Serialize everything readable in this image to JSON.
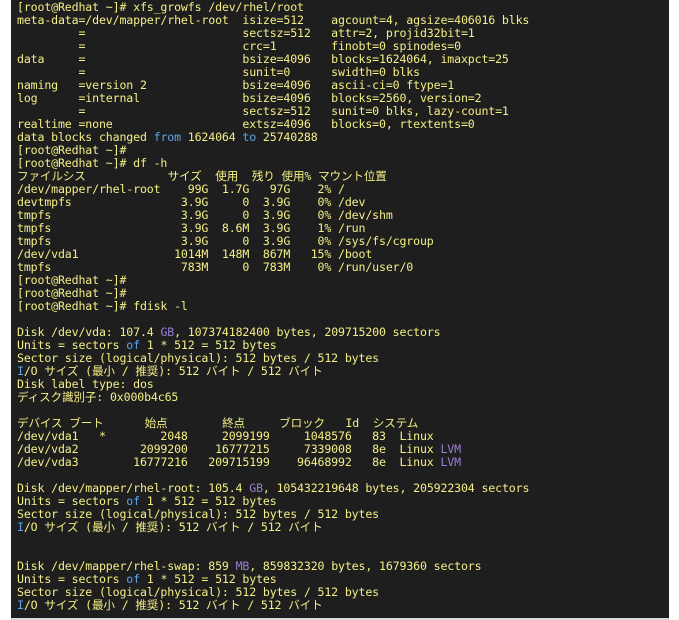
{
  "colors": {
    "background": "#1e1e1e",
    "text": "#f4ef86",
    "blue": "#5aa6e8",
    "purple": "#9a7ed6",
    "green": "#58b878"
  },
  "terminal": {
    "lines": [
      [
        {
          "t": "[root@Redhat ~]# xfs_growfs /dev/rhel/root",
          "c": "default"
        }
      ],
      [
        {
          "t": "meta-data=/dev/mapper/rhel-root  isize=512    agcount=4, agsize=406016 blks",
          "c": "default"
        }
      ],
      [
        {
          "t": "         =                       sectsz=512   attr=2, projid32bit=1",
          "c": "default"
        }
      ],
      [
        {
          "t": "         =                       crc=1        finobt=0 spinodes=0",
          "c": "default"
        }
      ],
      [
        {
          "t": "data     =                       bsize=4096   blocks=1624064, imaxpct=25",
          "c": "default"
        }
      ],
      [
        {
          "t": "         =                       sunit=0      swidth=0 blks",
          "c": "default"
        }
      ],
      [
        {
          "t": "naming   =version 2              bsize=4096   ascii-ci=0 ftype=1",
          "c": "default"
        }
      ],
      [
        {
          "t": "log      =internal               bsize=4096   blocks=2560, version=2",
          "c": "default"
        }
      ],
      [
        {
          "t": "         =                       sectsz=512   sunit=0 blks, lazy-count=1",
          "c": "default"
        }
      ],
      [
        {
          "t": "realtime =none                   extsz=4096   blocks=0, rtextents=0",
          "c": "default"
        }
      ],
      [
        {
          "t": "data blocks changed ",
          "c": "default"
        },
        {
          "t": "from",
          "c": "blue"
        },
        {
          "t": " 1624064 ",
          "c": "default"
        },
        {
          "t": "to",
          "c": "blue"
        },
        {
          "t": " 25740288",
          "c": "default"
        }
      ],
      [
        {
          "t": "[root@Redhat ~]#",
          "c": "default"
        }
      ],
      [
        {
          "t": "[root@Redhat ~]# df -h",
          "c": "default"
        }
      ],
      [
        {
          "t": "ファイルシス            サイズ  使用  残り 使用% マウント位置",
          "c": "default"
        }
      ],
      [
        {
          "t": "/dev/mapper/rhel-root    99G  1.7G   97G    2% /",
          "c": "default"
        }
      ],
      [
        {
          "t": "devtmpfs                3.9G     0  3.9G    0% /dev",
          "c": "default"
        }
      ],
      [
        {
          "t": "tmpfs                   3.9G     0  3.9G    0% /dev/shm",
          "c": "default"
        }
      ],
      [
        {
          "t": "tmpfs                   3.9G  8.6M  3.9G    1% /run",
          "c": "default"
        }
      ],
      [
        {
          "t": "tmpfs                   3.9G     0  3.9G    0% /sys/fs/cgroup",
          "c": "default"
        }
      ],
      [
        {
          "t": "/dev/vda1              1014M  148M  867M   15% /boot",
          "c": "default"
        }
      ],
      [
        {
          "t": "tmpfs                   783M     0  783M    0% /run/user/0",
          "c": "default"
        }
      ],
      [
        {
          "t": "[root@Redhat ~]#",
          "c": "default"
        }
      ],
      [
        {
          "t": "[root@Redhat ~]#",
          "c": "default"
        }
      ],
      [
        {
          "t": "[root@Redhat ~]# fdisk -l",
          "c": "default"
        }
      ],
      [
        {
          "t": "",
          "c": "default"
        }
      ],
      [
        {
          "t": "Disk /dev/vda: 107.4 ",
          "c": "default"
        },
        {
          "t": "GB",
          "c": "purple"
        },
        {
          "t": ", 107374182400 bytes, 209715200 sectors",
          "c": "default"
        }
      ],
      [
        {
          "t": "Units = sectors ",
          "c": "default"
        },
        {
          "t": "of",
          "c": "blue"
        },
        {
          "t": " 1 * 512 = 512 bytes",
          "c": "default"
        }
      ],
      [
        {
          "t": "Sector size (logical/physical): 512 bytes / 512 bytes",
          "c": "default"
        }
      ],
      [
        {
          "t": "I",
          "c": "blue"
        },
        {
          "t": "/O サイズ (最小 / 推奨): 512 バイト / 512 バイト",
          "c": "default"
        }
      ],
      [
        {
          "t": "Disk label type: dos",
          "c": "default"
        }
      ],
      [
        {
          "t": "ディスク識別子: 0x000b4c65",
          "c": "default"
        }
      ],
      [
        {
          "t": "",
          "c": "default"
        }
      ],
      [
        {
          "t": "デバイス ブート      始点        終点     ブロック   Id  システム",
          "c": "default"
        }
      ],
      [
        {
          "t": "/dev/vda1   *        2048     2099199     1048576   83  Linux",
          "c": "default"
        }
      ],
      [
        {
          "t": "/dev/vda2         2099200    16777215     7339008   8e  Linux ",
          "c": "default"
        },
        {
          "t": "LVM",
          "c": "purple"
        }
      ],
      [
        {
          "t": "/dev/vda3        16777216   209715199    96468992   8e  Linux ",
          "c": "default"
        },
        {
          "t": "LVM",
          "c": "purple"
        }
      ],
      [
        {
          "t": "",
          "c": "default"
        }
      ],
      [
        {
          "t": "Disk /dev/mapper/rhel-root: 105.4 ",
          "c": "default"
        },
        {
          "t": "GB",
          "c": "purple"
        },
        {
          "t": ", 105432219648 bytes, 205922304 sectors",
          "c": "default"
        }
      ],
      [
        {
          "t": "Units = sectors ",
          "c": "default"
        },
        {
          "t": "of",
          "c": "blue"
        },
        {
          "t": " 1 * 512 = 512 bytes",
          "c": "default"
        }
      ],
      [
        {
          "t": "Sector size (logical/physical): 512 bytes / 512 bytes",
          "c": "default"
        }
      ],
      [
        {
          "t": "I",
          "c": "blue"
        },
        {
          "t": "/O サイズ (最小 / 推奨): 512 バイト / 512 バイト",
          "c": "default"
        }
      ],
      [
        {
          "t": "",
          "c": "default"
        }
      ],
      [
        {
          "t": "",
          "c": "default"
        }
      ],
      [
        {
          "t": "Disk /dev/mapper/rhel-swap: 859 ",
          "c": "default"
        },
        {
          "t": "MB",
          "c": "purple"
        },
        {
          "t": ", 859832320 bytes, 1679360 sectors",
          "c": "default"
        }
      ],
      [
        {
          "t": "Units = sectors ",
          "c": "default"
        },
        {
          "t": "of",
          "c": "blue"
        },
        {
          "t": " 1 * 512 = 512 bytes",
          "c": "default"
        }
      ],
      [
        {
          "t": "Sector size (logical/physical): 512 bytes / 512 bytes",
          "c": "default"
        }
      ],
      [
        {
          "t": "I",
          "c": "blue"
        },
        {
          "t": "/O サイズ (最小 / 推奨): 512 バイト / 512 バイト",
          "c": "default"
        }
      ]
    ]
  }
}
